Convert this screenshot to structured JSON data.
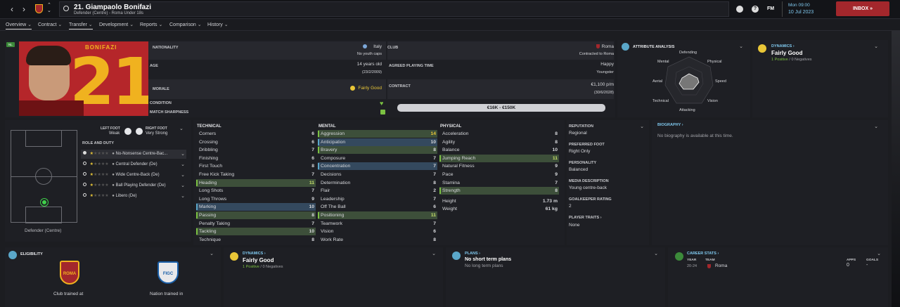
{
  "header": {
    "title": "21. Giampaolo Bonifazi",
    "subtitle": "Defender (Centre) - Roma Under 18s",
    "date_time": "Mon 09:00",
    "date": "10 Jul 2023",
    "fm_label": "FM",
    "inbox_label": "INBOX"
  },
  "tabs": [
    {
      "label": "Overview"
    },
    {
      "label": "Contract"
    },
    {
      "label": "Transfer"
    },
    {
      "label": "Development"
    },
    {
      "label": "Reports"
    },
    {
      "label": "Comparison"
    },
    {
      "label": "History"
    }
  ],
  "profile": {
    "badge": "NL",
    "shirt_name": "BONIFAZI",
    "shirt_number": "21",
    "nationality_label": "NATIONALITY",
    "nationality": "Italy",
    "youth_caps": "No youth caps",
    "club_label": "CLUB",
    "club": "Roma",
    "contract_with": "Contracted to Roma",
    "age_label": "AGE",
    "age": "14 years old",
    "dob": "(23/2/2009)",
    "agreed_label": "AGREED PLAYING TIME",
    "agreed": "Happy",
    "agreed_sub": "Youngster",
    "morale_label": "MORALE",
    "morale": "Fairly Good",
    "contract_label": "CONTRACT",
    "wage": "€1,100 p/m",
    "contract_end": "(30/6/2028)",
    "condition_label": "CONDITION",
    "sharpness_label": "MATCH SHARPNESS",
    "value_range": "€16K - €150K"
  },
  "attribute_analysis": {
    "title": "ATTRIBUTE ANALYSIS",
    "axes": [
      "Defending",
      "Physical",
      "Speed",
      "Vision",
      "Attacking",
      "Technical",
      "Aerial",
      "Mental"
    ]
  },
  "dynamics": {
    "title": "DYNAMICS",
    "value": "Fairly Good",
    "positive": "1 Positive",
    "separator": "/",
    "negative": "0 Negatives"
  },
  "position_panel": {
    "caption": "Defender (Centre)",
    "left_foot_label": "LEFT FOOT",
    "left_foot": "Weak",
    "right_foot_label": "RIGHT FOOT",
    "right_foot": "Very Strong",
    "role_title": "ROLE AND DUTY",
    "roles": [
      "No-Nonsense Centre-Bac...",
      "Central Defender (De)",
      "Wide Centre-Back (De)",
      "Ball Playing Defender (De)",
      "Libero (De)"
    ]
  },
  "technical": {
    "title": "TECHNICAL",
    "rows": [
      [
        "Corners",
        "6"
      ],
      [
        "Crossing",
        "6"
      ],
      [
        "Dribbling",
        "7"
      ],
      [
        "Finishing",
        "6"
      ],
      [
        "First Touch",
        "8"
      ],
      [
        "Free Kick Taking",
        "7"
      ],
      [
        "Heading",
        "11"
      ],
      [
        "Long Shots",
        "7"
      ],
      [
        "Long Throws",
        "9"
      ],
      [
        "Marking",
        "10"
      ],
      [
        "Passing",
        "8"
      ],
      [
        "Penalty Taking",
        "7"
      ],
      [
        "Tackling",
        "10"
      ],
      [
        "Technique",
        "8"
      ]
    ]
  },
  "mental": {
    "title": "MENTAL",
    "rows": [
      [
        "Aggression",
        "14"
      ],
      [
        "Anticipation",
        "10"
      ],
      [
        "Bravery",
        "8"
      ],
      [
        "Composure",
        "7"
      ],
      [
        "Concentration",
        "7"
      ],
      [
        "Decisions",
        "7"
      ],
      [
        "Determination",
        "8"
      ],
      [
        "Flair",
        "2"
      ],
      [
        "Leadership",
        "7"
      ],
      [
        "Off The Ball",
        "6"
      ],
      [
        "Positioning",
        "11"
      ],
      [
        "Teamwork",
        "7"
      ],
      [
        "Vision",
        "6"
      ],
      [
        "Work Rate",
        "8"
      ]
    ]
  },
  "physical": {
    "title": "PHYSICAL",
    "rows": [
      [
        "Acceleration",
        "8"
      ],
      [
        "Agility",
        "8"
      ],
      [
        "Balance",
        "10"
      ],
      [
        "Jumping Reach",
        "11"
      ],
      [
        "Natural Fitness",
        "9"
      ],
      [
        "Pace",
        "9"
      ],
      [
        "Stamina",
        "7"
      ],
      [
        "Strength",
        "8"
      ]
    ],
    "height_label": "Height",
    "height": "1.73 m",
    "weight_label": "Weight",
    "weight": "61 kg"
  },
  "info": {
    "reputation_label": "REPUTATION",
    "reputation": "Regional",
    "foot_label": "PREFERRED FOOT",
    "foot": "Right Only",
    "personality_label": "PERSONALITY",
    "personality": "Balanced",
    "media_label": "MEDIA DESCRIPTION",
    "media": "Young centre-back",
    "gk_label": "GOALKEEPER RATING",
    "gk": "2",
    "traits_label": "PLAYER TRAITS",
    "traits": "None"
  },
  "biography": {
    "title": "BIOGRAPHY",
    "text": "No biography is available at this time."
  },
  "eligibility": {
    "title": "ELIGIBILITY",
    "club_caption": "Club trained at",
    "nation_caption": "Nation trained in",
    "club_crest": "ROMA",
    "nation_crest": "FIGC"
  },
  "plans": {
    "title": "PLANS",
    "short": "No short term plans",
    "long": "No long term plans"
  },
  "career": {
    "title": "CAREER STATS",
    "year_label": "YEAR",
    "team_label": "TEAM",
    "apps_label": "APPS",
    "goals_label": "GOALS",
    "year": "20-24",
    "team": "Roma",
    "apps": "0",
    "goals": "-"
  },
  "colors": {
    "accent_green": "#7bc142",
    "accent_yellow": "#e9c637",
    "inbox": "#a3272c",
    "shirt": "#b5262a",
    "shirt_number": "#f0b21f"
  }
}
